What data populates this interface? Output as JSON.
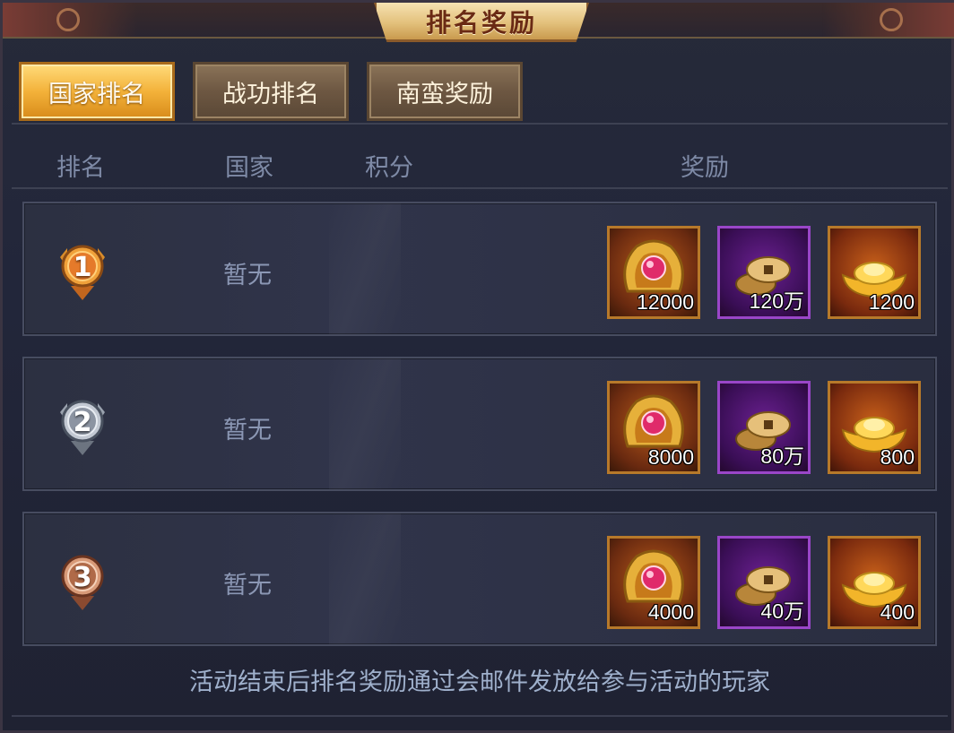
{
  "window": {
    "title": "排名奖励"
  },
  "tabs": [
    {
      "label": "国家排名",
      "active": true
    },
    {
      "label": "战功排名",
      "active": false
    },
    {
      "label": "南蛮奖励",
      "active": false
    }
  ],
  "table": {
    "headers": {
      "rank": "排名",
      "nation": "国家",
      "score": "积分",
      "reward": "奖励"
    },
    "rows": [
      {
        "rank": "1",
        "medal": "gold-medal-icon",
        "nation": "暂无",
        "rewards": [
          {
            "icon": "gem-badge-icon",
            "qty": "12000"
          },
          {
            "icon": "copper-coins-icon",
            "qty": "120万"
          },
          {
            "icon": "gold-ingot-icon",
            "qty": "1200"
          }
        ]
      },
      {
        "rank": "2",
        "medal": "silver-medal-icon",
        "nation": "暂无",
        "rewards": [
          {
            "icon": "gem-badge-icon",
            "qty": "8000"
          },
          {
            "icon": "copper-coins-icon",
            "qty": "80万"
          },
          {
            "icon": "gold-ingot-icon",
            "qty": "800"
          }
        ]
      },
      {
        "rank": "3",
        "medal": "bronze-medal-icon",
        "nation": "暂无",
        "rewards": [
          {
            "icon": "gem-badge-icon",
            "qty": "4000"
          },
          {
            "icon": "copper-coins-icon",
            "qty": "40万"
          },
          {
            "icon": "gold-ingot-icon",
            "qty": "400"
          }
        ]
      }
    ]
  },
  "footer": {
    "note": "活动结束后排名奖励通过会邮件发放给参与活动的玩家"
  },
  "colors": {
    "gold": "#f3b23a",
    "silver": "#b8c0cc",
    "bronze": "#c08060",
    "reward_border_orange": "#b7792a",
    "reward_border_purple": "#9a46c8"
  }
}
